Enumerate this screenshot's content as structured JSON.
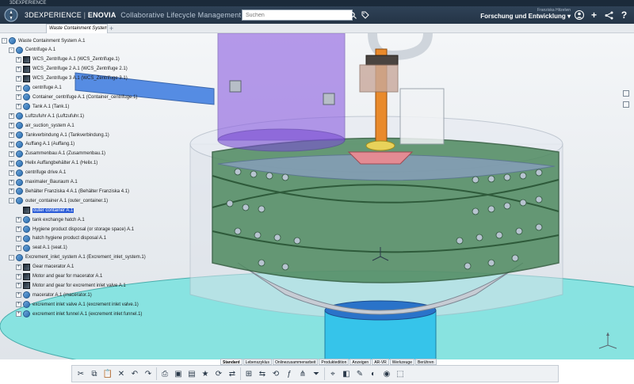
{
  "os_title": "3DEXPERIENCE",
  "topbar": {
    "brand_prefix": "3DEXPERIENCE",
    "brand_sep": " | ",
    "brand_app": "ENOVIA",
    "brand_desc": "Collaborative Lifecycle Management",
    "search_placeholder": "Suchen",
    "user_role": "Franziska Hitzelwn",
    "context": "Forschung und Entwicklung ▾",
    "icons": [
      "user-profile-icon",
      "add-icon",
      "share-icon",
      "help-icon"
    ]
  },
  "tab": {
    "label": "Waste Containment System",
    "add": "+"
  },
  "tree": {
    "rows": [
      {
        "label": "Waste Containment System A.1",
        "icon": "product",
        "expand": "-",
        "level": 0
      },
      {
        "label": "Centrifuge A.1",
        "icon": "product",
        "expand": "-",
        "level": 1
      },
      {
        "label": "WCS_Zentrifuge A.1 (WCS_Zentrifuge.1)",
        "icon": "rep",
        "expand": "+",
        "level": 2
      },
      {
        "label": "WCS_Zentrifuge 2 A.1 (WCS_Zentrifuge 2.1)",
        "icon": "rep",
        "expand": "+",
        "level": 2
      },
      {
        "label": "WCS_Zentrifuge 3 A.1 (WCS_Zentrifuge 3.1)",
        "icon": "rep",
        "expand": "+",
        "level": 2
      },
      {
        "label": "centrifuge A.1",
        "icon": "product",
        "expand": "+",
        "level": 2
      },
      {
        "label": "Container_centrifuge A.1 (Container_centrifuge.1)",
        "icon": "product",
        "expand": "+",
        "level": 2
      },
      {
        "label": "Tank A.1 (Tank.1)",
        "icon": "product",
        "expand": "+",
        "level": 2
      },
      {
        "label": "Luftzufuhr A.1 (Luftzufuhr.1)",
        "icon": "product",
        "expand": "+",
        "level": 1
      },
      {
        "label": "air_suction_system A.1",
        "icon": "product",
        "expand": "+",
        "level": 1
      },
      {
        "label": "Tankverbindung A.1 (Tankverbindung.1)",
        "icon": "product",
        "expand": "+",
        "level": 1
      },
      {
        "label": "Auffang A.1 (Auffang.1)",
        "icon": "product",
        "expand": "+",
        "level": 1
      },
      {
        "label": "Zusammenbau A.1 (Zusammenbau.1)",
        "icon": "product",
        "expand": "+",
        "level": 1
      },
      {
        "label": "Helix Auffangbehälter A.1 (Helix.1)",
        "icon": "product",
        "expand": "+",
        "level": 1
      },
      {
        "label": "centrifuge drive A.1",
        "icon": "product",
        "expand": "+",
        "level": 1
      },
      {
        "label": "maximaler_Bauraum A.1",
        "icon": "product",
        "expand": "+",
        "level": 1
      },
      {
        "label": "Behälter Franziska 4 A.1 (Behälter Franziska 4.1)",
        "icon": "product",
        "expand": "+",
        "level": 1
      },
      {
        "label": "outer_container A.1 (outer_container.1)",
        "icon": "product",
        "expand": "-",
        "level": 1
      },
      {
        "label": "outer container A.1",
        "icon": "rep",
        "expand": "",
        "level": 2,
        "selected": true
      },
      {
        "label": "tank exchange hatch A.1",
        "icon": "product",
        "expand": "+",
        "level": 2
      },
      {
        "label": "Hygiene product disposal (or storage space) A.1",
        "icon": "product",
        "expand": "+",
        "level": 2
      },
      {
        "label": "hatch hygiene product disposal A.1",
        "icon": "product",
        "expand": "+",
        "level": 2
      },
      {
        "label": "seat A.1 (seat.1)",
        "icon": "product",
        "expand": "+",
        "level": 2
      },
      {
        "label": "Excrement_inlet_system A.1 (Excrement_inlet_system.1)",
        "icon": "product",
        "expand": "-",
        "level": 1
      },
      {
        "label": "Gear macerator A.1",
        "icon": "rep",
        "expand": "+",
        "level": 2
      },
      {
        "label": "Motor and gear for macerator A.1",
        "icon": "rep",
        "expand": "+",
        "level": 2
      },
      {
        "label": "Motor and gear for excrement inlet valve A.1",
        "icon": "rep",
        "expand": "+",
        "level": 2
      },
      {
        "label": "macerator A.1 (macerator.1)",
        "icon": "product",
        "expand": "+",
        "level": 2
      },
      {
        "label": "excrement inlet valve A.1 (excrement inlet valve.1)",
        "icon": "product",
        "expand": "+",
        "level": 2
      },
      {
        "label": "excrement inlet funnel A.1 (excrement inlet funnel.1)",
        "icon": "product",
        "expand": "+",
        "level": 2
      }
    ]
  },
  "bottom_tabs": [
    "Standard",
    "Lebenszyklus",
    "Onlinezusammenarbeit",
    "Produktedition",
    "Anzeigen",
    "AR-VR",
    "Werkzeuge",
    "Berühren"
  ],
  "bottom_active": "Standard",
  "toolbar_icons": [
    "cut-icon",
    "copy-icon",
    "paste-icon",
    "delete-icon",
    "undo-icon",
    "redo-icon",
    "print-icon",
    "save-icon",
    "open-icon",
    "favorite-icon",
    "refresh-icon",
    "sync-icon",
    "insert-icon",
    "replace-icon",
    "update-icon",
    "formula-icon",
    "tree-icon",
    "filter-icon",
    "measure-icon",
    "section-icon",
    "paint-icon",
    "hide-icon",
    "show-icon",
    "capture-icon"
  ]
}
